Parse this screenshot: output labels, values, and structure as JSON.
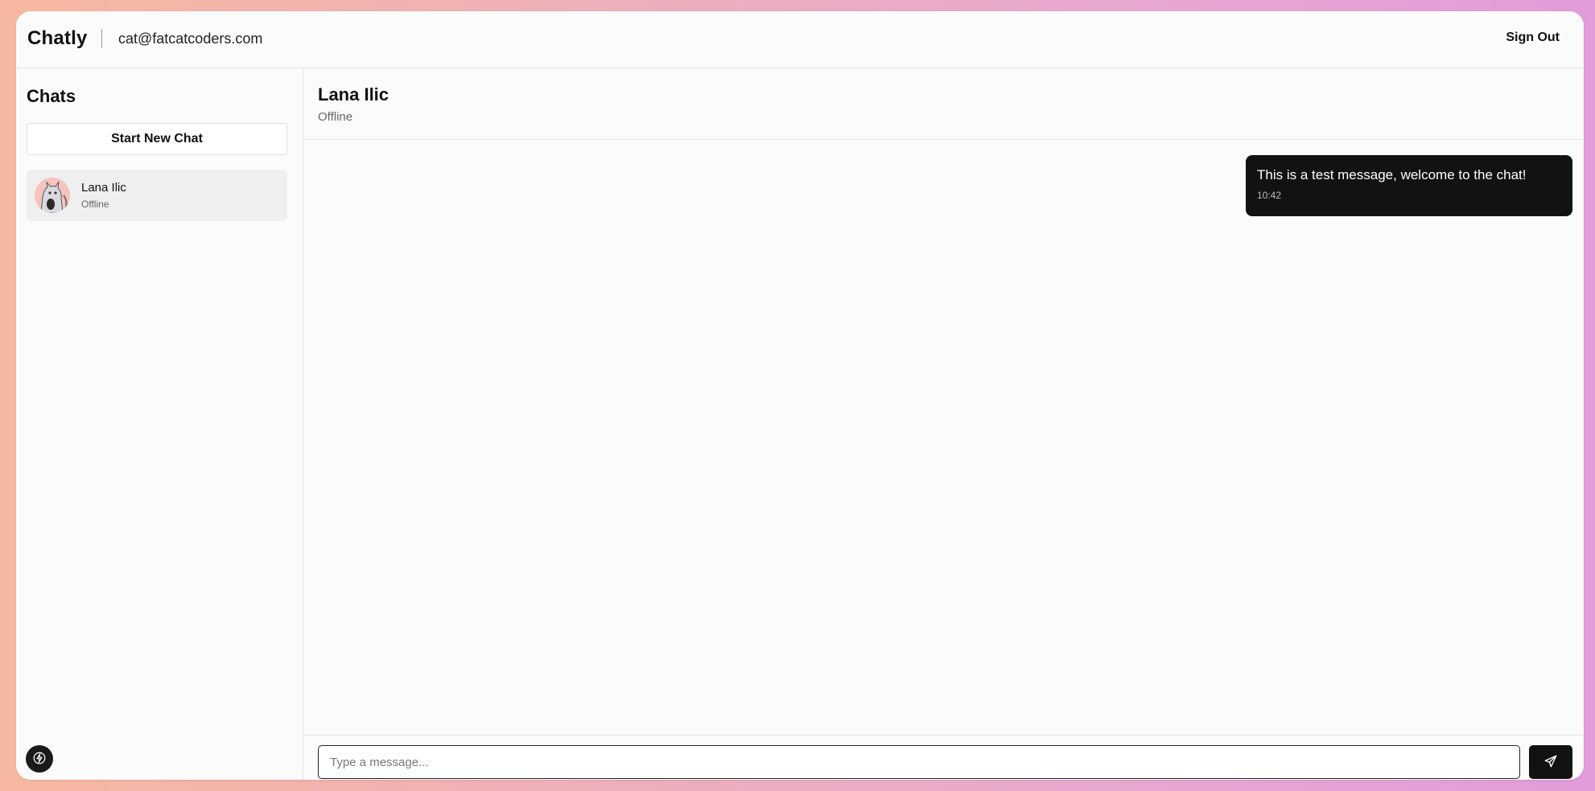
{
  "app": {
    "title": "Chatly",
    "user_email": "cat@fatcatcoders.com",
    "sign_out_label": "Sign Out"
  },
  "sidebar": {
    "title": "Chats",
    "new_chat_label": "Start New Chat",
    "chats": [
      {
        "name": "Lana Ilic",
        "status": "Offline",
        "avatar_icon": "cat-avatar-icon",
        "selected": true
      }
    ],
    "quick_action_icon": "lightning-bolt-icon"
  },
  "conversation": {
    "contact_name": "Lana Ilic",
    "contact_status": "Offline",
    "messages": [
      {
        "text": "This is a test message, welcome to the chat!",
        "time": "10:42",
        "outgoing": true
      }
    ]
  },
  "composer": {
    "placeholder": "Type a message...",
    "value": "",
    "send_icon": "send-icon"
  },
  "colors": {
    "accent": "#121212",
    "background": "#fbfbfb",
    "selected_item": "#efefef",
    "border": "#e6e6e6"
  }
}
